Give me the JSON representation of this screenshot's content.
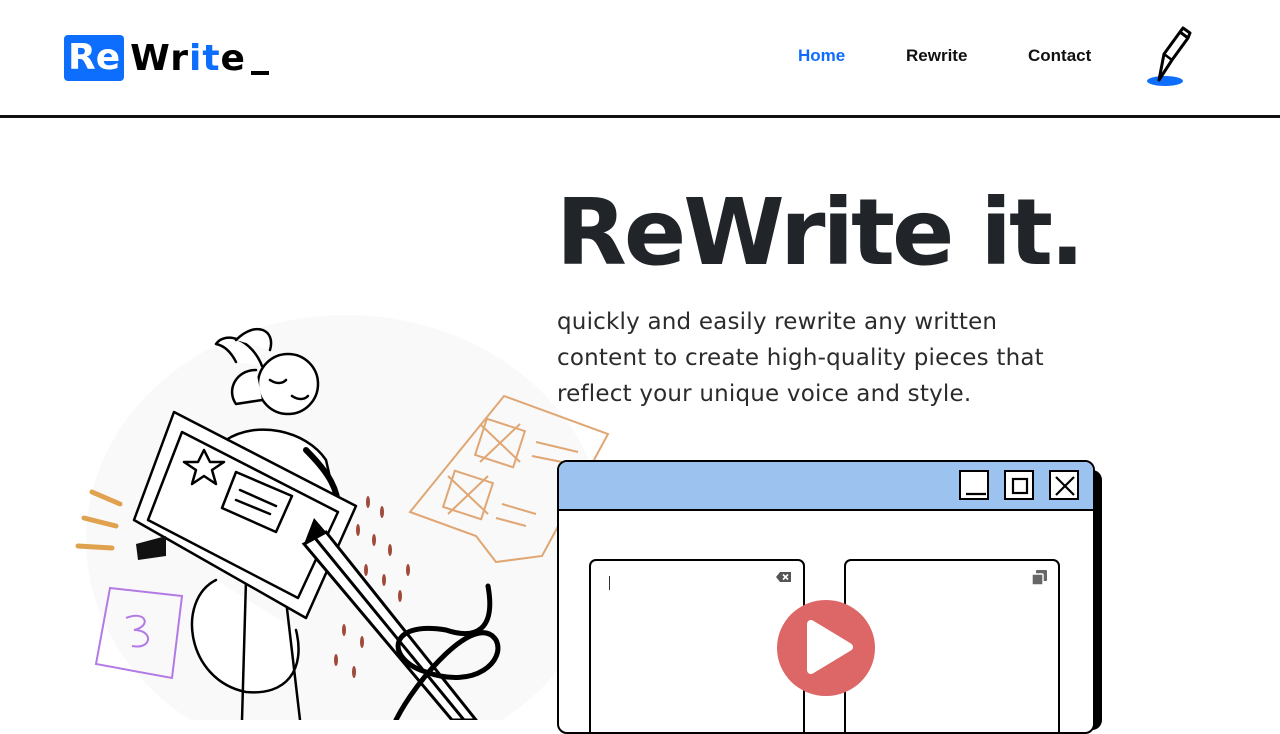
{
  "brand": {
    "logo_part1": "Re",
    "logo_part2": "Wr",
    "logo_part3": "it",
    "logo_part4": "e",
    "accent_color": "#0d6efd"
  },
  "nav": {
    "items": [
      {
        "label": "Home",
        "active": true
      },
      {
        "label": "Rewrite",
        "active": false
      },
      {
        "label": "Contact",
        "active": false
      }
    ],
    "pen_icon": "pen-icon"
  },
  "hero": {
    "title": "ReWrite it.",
    "subtitle": "quickly and easily rewrite any written content to create high-quality pieces that reflect your unique voice and style."
  },
  "app_window": {
    "titlebar_color": "#9cc2ef",
    "controls": [
      "minimize-icon",
      "maximize-icon",
      "close-icon"
    ],
    "input_panel_icon": "clear-text-icon",
    "output_panel_icon": "copy-icon",
    "play_color": "#dd6666"
  },
  "illustration": {
    "description_icon": "woman-with-giant-pencil-illustration"
  }
}
